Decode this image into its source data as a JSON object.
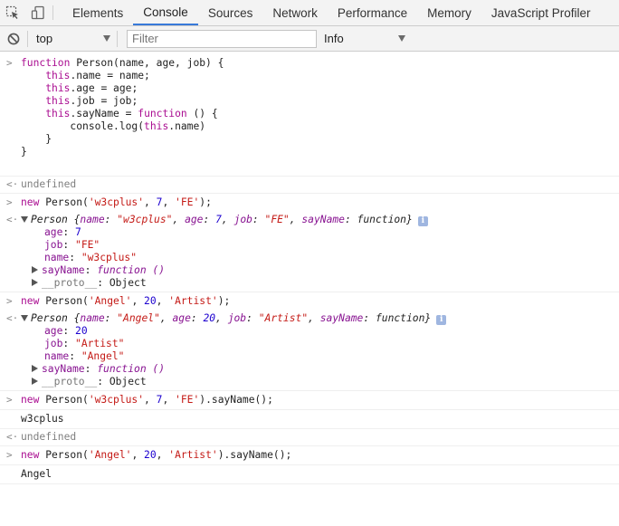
{
  "tabs": [
    {
      "label": "Elements",
      "active": false
    },
    {
      "label": "Console",
      "active": true
    },
    {
      "label": "Sources",
      "active": false
    },
    {
      "label": "Network",
      "active": false
    },
    {
      "label": "Performance",
      "active": false
    },
    {
      "label": "Memory",
      "active": false
    },
    {
      "label": "JavaScript Profiler",
      "active": false
    }
  ],
  "icons": {
    "inspect": "inspect-element-icon",
    "device": "device-toolbar-icon",
    "clear": "clear-console-icon",
    "input_prompt": ">",
    "output_prompt": "<·",
    "info": "i"
  },
  "filterbar": {
    "context": "top",
    "filter_placeholder": "Filter",
    "level": "Info"
  },
  "console": {
    "input1": {
      "l1": {
        "kw": "function",
        "rest": " Person(name, age, job) {"
      },
      "l2": {
        "this": "this",
        "rest": ".name = name;"
      },
      "l3": {
        "this": "this",
        "rest": ".age = age;"
      },
      "l4": {
        "this": "this",
        "rest": ".job = job;"
      },
      "l5": {
        "this": "this",
        "mid": ".sayName = ",
        "kw": "function",
        "rest": " () {"
      },
      "l6": {
        "pre": "console.log(",
        "this": "this",
        "rest": ".name)"
      },
      "l7": "}",
      "l8": "}"
    },
    "undefined": "undefined",
    "person1": {
      "input": {
        "kw": "new",
        "pre": " Person(",
        "s1": "'w3cplus'",
        "c1": ", ",
        "n1": "7",
        "c2": ", ",
        "s2": "'FE'",
        "post": ");"
      },
      "summary": {
        "name_key": "name",
        "name_val": "\"w3cplus\"",
        "age_key": "age",
        "age_val": "7",
        "job_key": "job",
        "job_val": "\"FE\"",
        "fn_key": "sayName",
        "fn_val": "function"
      },
      "props": {
        "age_key": "age",
        "age_val": "7",
        "job_key": "job",
        "job_val": "\"FE\"",
        "name_key": "name",
        "name_val": "\"w3cplus\"",
        "fn_key": "sayName",
        "fn_val": "function ()",
        "proto_key": "__proto__",
        "proto_val": "Object"
      }
    },
    "person2": {
      "input": {
        "kw": "new",
        "pre": " Person(",
        "s1": "'Angel'",
        "c1": ", ",
        "n1": "20",
        "c2": ", ",
        "s2": "'Artist'",
        "post": ");"
      },
      "summary": {
        "name_key": "name",
        "name_val": "\"Angel\"",
        "age_key": "age",
        "age_val": "20",
        "job_key": "job",
        "job_val": "\"Artist\"",
        "fn_key": "sayName",
        "fn_val": "function"
      },
      "props": {
        "age_key": "age",
        "age_val": "20",
        "job_key": "job",
        "job_val": "\"Artist\"",
        "name_key": "name",
        "name_val": "\"Angel\"",
        "fn_key": "sayName",
        "fn_val": "function ()",
        "proto_key": "__proto__",
        "proto_val": "Object"
      }
    },
    "call1": {
      "input": {
        "kw": "new",
        "pre": " Person(",
        "s1": "'w3cplus'",
        "c1": ", ",
        "n1": "7",
        "c2": ", ",
        "s2": "'FE'",
        "post": ").sayName();"
      },
      "log": "w3cplus"
    },
    "call2": {
      "input": {
        "kw": "new",
        "pre": " Person(",
        "s1": "'Angel'",
        "c1": ", ",
        "n1": "20",
        "c2": ", ",
        "s2": "'Artist'",
        "post": ").sayName();"
      },
      "log": "Angel"
    },
    "object_label": "Person"
  }
}
